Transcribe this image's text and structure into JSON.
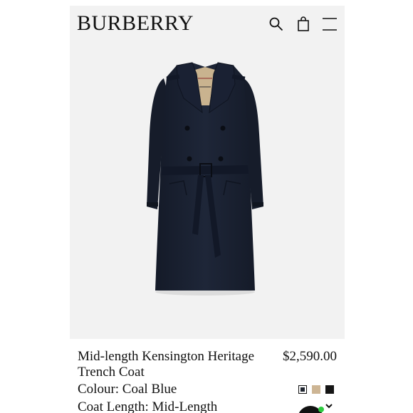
{
  "header": {
    "brand": "BURBERRY",
    "icons": [
      "search-icon",
      "shopping-bag-icon",
      "menu-icon"
    ]
  },
  "product": {
    "title": "Mid-length Kensington Heritage Trench Coat",
    "price": "$2,590.00",
    "colour_label": "Colour: Coal Blue",
    "length_label": "Coat Length: Mid-Length",
    "swatches": [
      {
        "name": "coal-blue",
        "color": "#1f2530",
        "selected": true
      },
      {
        "name": "honey",
        "color": "#cdb594",
        "selected": false
      },
      {
        "name": "black",
        "color": "#151515",
        "selected": false
      }
    ]
  },
  "colors": {
    "coat": "#1b2234",
    "background": "#f2f2f2",
    "panel": "#ffffff",
    "online_dot": "#2ecc40"
  }
}
